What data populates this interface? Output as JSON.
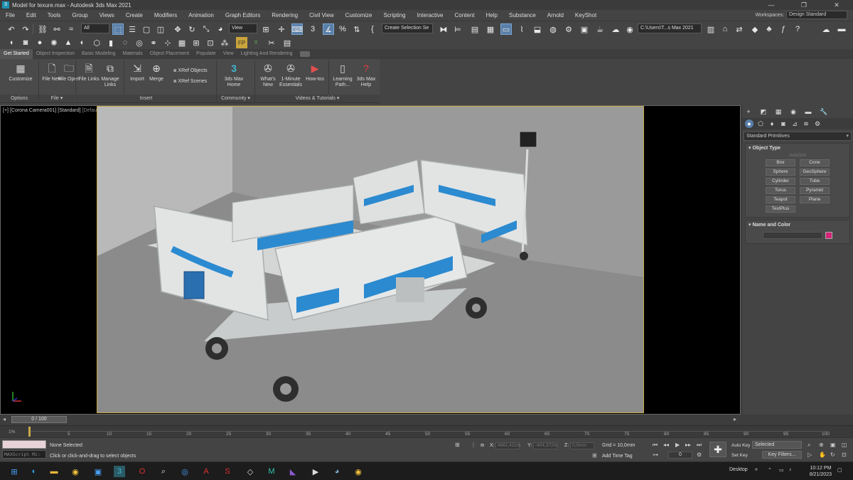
{
  "window": {
    "title": "Model for texure.max - Autodesk 3ds Max 2021",
    "app_icon_text": "3",
    "controls": [
      "—",
      "❐",
      "✕"
    ]
  },
  "menu": {
    "items": [
      "File",
      "Edit",
      "Tools",
      "Group",
      "Views",
      "Create",
      "Modifiers",
      "Animation",
      "Graph Editors",
      "Rendering",
      "Civil View",
      "Customize",
      "Scripting",
      "Interactive",
      "Content",
      "Help",
      "Substance",
      "Arnold",
      "KeyShot"
    ],
    "workspaces_label": "Workspaces:",
    "workspace_value": "Design Standard"
  },
  "toolbar": {
    "filter_value": "All",
    "view_value": "View",
    "named_selection_placeholder": "Create Selection Se",
    "project_path": "C:\\Users\\T...s Max 2021"
  },
  "ribbon": {
    "tabs": [
      "Get Started",
      "Object Inspection",
      "Basic Modeling",
      "Materials",
      "Object Placement",
      "Populate",
      "View",
      "Lighting And Rendering"
    ],
    "buttons": {
      "customize": "Customize",
      "file_new": "File New",
      "file_open": "File Open",
      "file_links": "File Links",
      "manage_links": "Manage Links",
      "import": "Import",
      "merge": "Merge",
      "xref_objects": "XRef Objects",
      "xref_scenes": "XRef Scenes",
      "max_home": "3ds Max Home",
      "whats_new": "What's New",
      "one_minute": "1-Minute Essentials",
      "how_tos": "How-tos",
      "learning_path": "Learning Path...",
      "max_help": "3ds Max Help"
    },
    "groups": {
      "options": "Options",
      "file": "File ▾",
      "insert": "Insert",
      "community": "Community ▾",
      "videos": "Videos & Tutorials ▾"
    }
  },
  "viewport": {
    "label_bracket": "[+]",
    "label_camera": "[Corona Camera001]",
    "label_standard": "[Standard]",
    "label_shading": "[Default Shading]"
  },
  "command_panel": {
    "category": "Standard Primitives",
    "object_type_title": "Object Type",
    "autogrid": "AutoGrid",
    "objects": [
      "Box",
      "Cone",
      "Sphere",
      "GeoSphere",
      "Cylinder",
      "Tube",
      "Torus",
      "Pyramid",
      "Teapot",
      "Plane",
      "TextPlus"
    ],
    "name_color_title": "Name and Color",
    "swatch_color": "#d42577"
  },
  "timeline": {
    "slider": "0 / 100",
    "ticks": [
      "5",
      "10",
      "15",
      "20",
      "25",
      "30",
      "35",
      "40",
      "45",
      "50",
      "55",
      "60",
      "65",
      "70",
      "75",
      "80",
      "85",
      "90",
      "95",
      "100"
    ],
    "first_tick": "1%"
  },
  "status": {
    "maxscript": "MAXScript Mi:",
    "selection": "None Selected",
    "prompt": "Click or click-and-drag to select objects",
    "x_label": "X:",
    "x_value": "4661,411m",
    "y_label": "Y:",
    "y_value": "-404,372m",
    "z_label": "Z:",
    "z_value": "0,0mm",
    "grid": "Grid = 10,0mm",
    "add_time_tag": "Add Time Tag",
    "auto_key": "Auto Key",
    "set_key": "Set Key",
    "selected": "Selected",
    "key_filters": "Key Filters...",
    "frame": "0"
  },
  "taskbar": {
    "desktop": "Desktop",
    "time": "10:12 PM",
    "date": "8/21/2023"
  }
}
